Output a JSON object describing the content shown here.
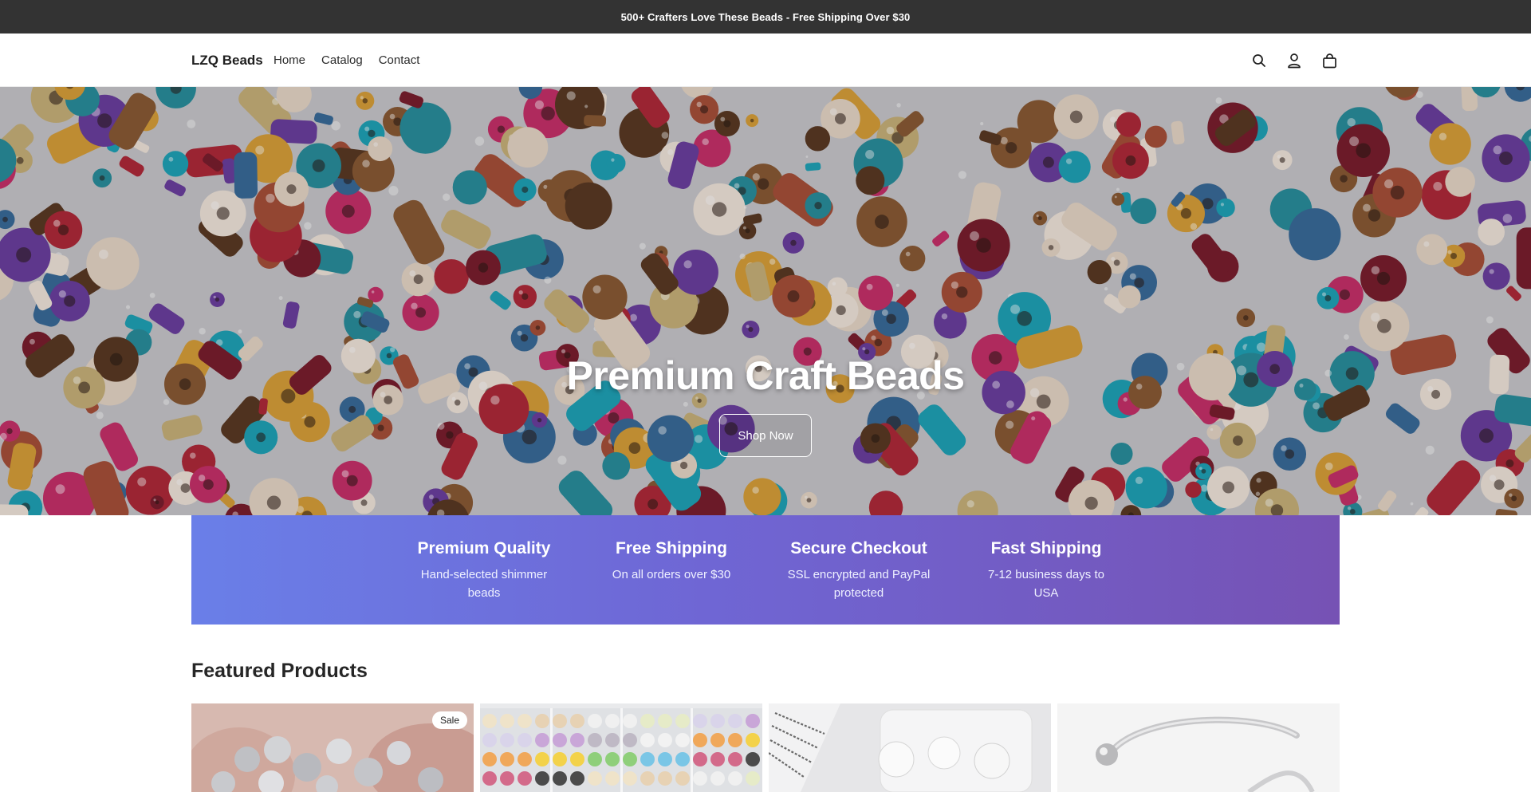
{
  "announcement": {
    "text": "500+ Crafters Love These Beads - Free Shipping Over $30"
  },
  "header": {
    "logo": "LZQ Beads",
    "nav": [
      "Home",
      "Catalog",
      "Contact"
    ],
    "icons": [
      "search-icon",
      "account-icon",
      "cart-icon"
    ]
  },
  "hero": {
    "title": "Premium Craft Beads",
    "button": "Shop Now"
  },
  "features": [
    {
      "title": "Premium Quality",
      "text": "Hand-selected shimmer beads"
    },
    {
      "title": "Free Shipping",
      "text": "On all orders over $30"
    },
    {
      "title": "Secure Checkout",
      "text": "SSL encrypted and PayPal protected"
    },
    {
      "title": "Fast Shipping",
      "text": "7-12 business days to USA"
    }
  ],
  "featured": {
    "title": "Featured Products",
    "products": [
      {
        "badge": "Sale"
      },
      {
        "badge": ""
      },
      {
        "badge": ""
      },
      {
        "badge": ""
      }
    ]
  },
  "colors": {
    "announcement_bg": "#333333",
    "features_gradient_start": "#6a7fe8",
    "features_gradient_end": "#7652b4"
  }
}
